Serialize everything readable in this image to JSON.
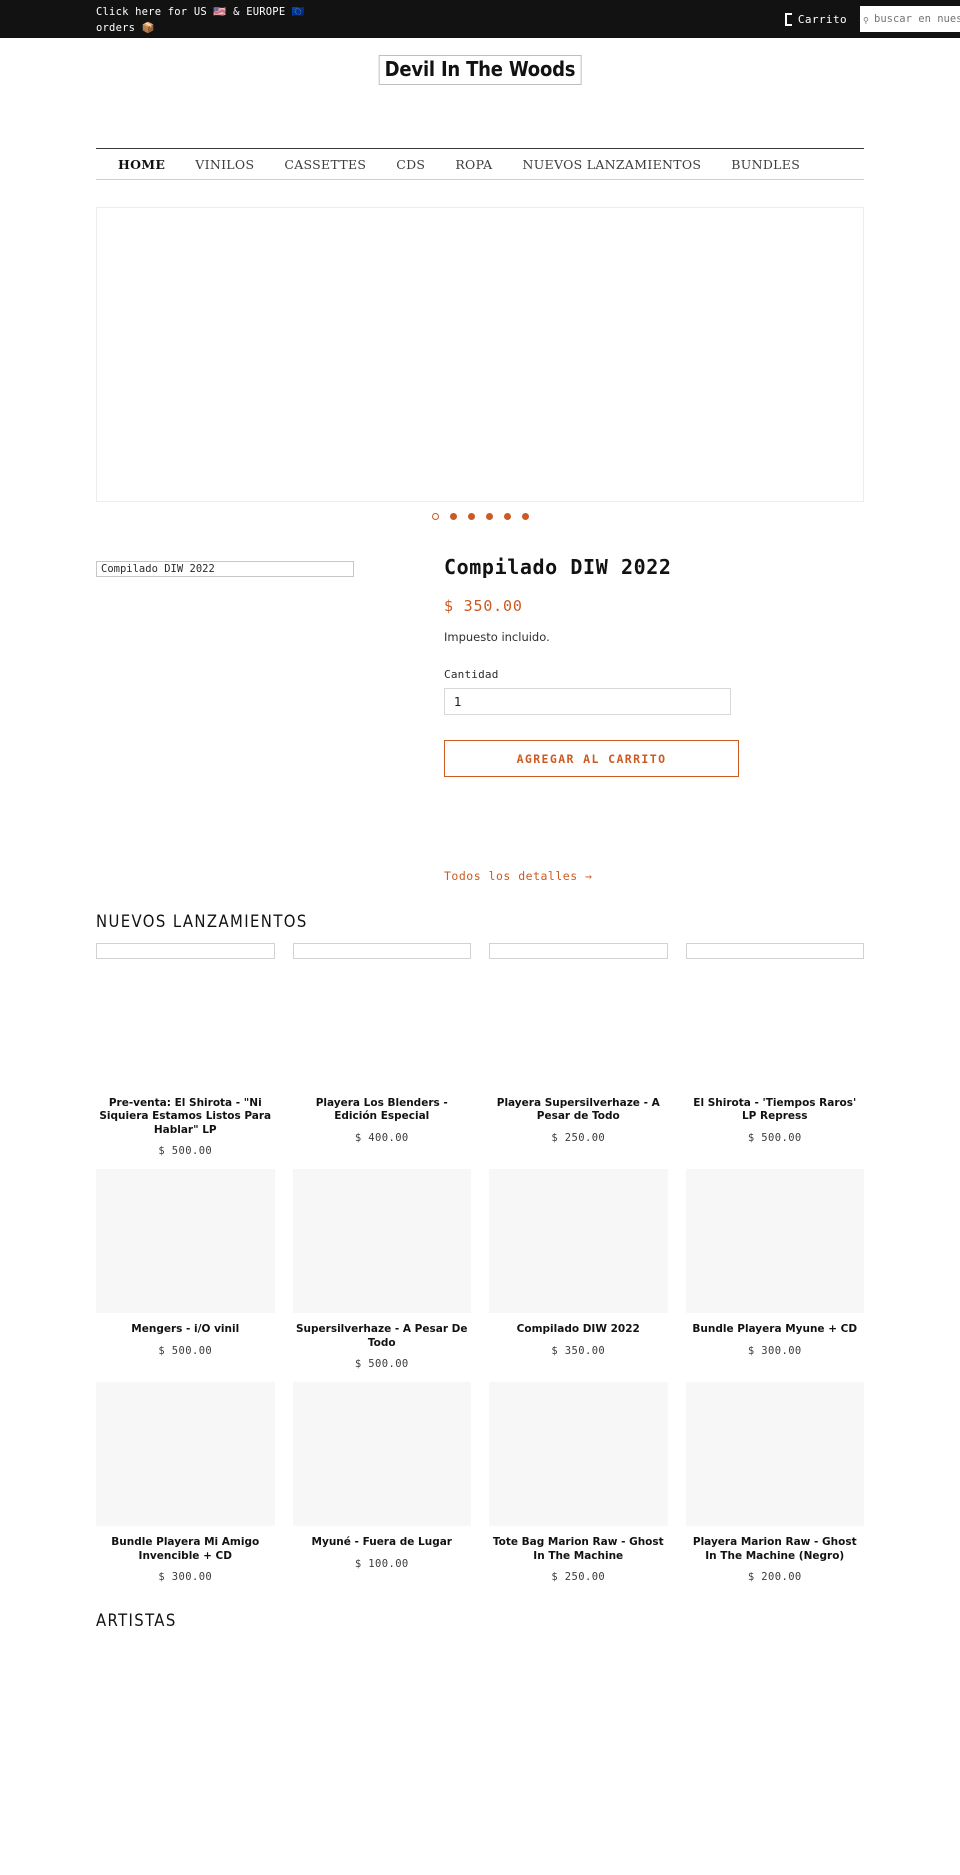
{
  "announcement": {
    "text": "Click here for US 🇺🇸 & EUROPE 🇪🇺 orders 📦",
    "cart_label": "Carrito",
    "cart_icon": "cart-icon",
    "search_placeholder": "buscar en nuestra tienda",
    "search_value": "",
    "search_icon": "search-icon"
  },
  "header": {
    "logo_alt": "Devil In The Woods"
  },
  "nav": {
    "items": [
      {
        "label": "HOME",
        "active": true
      },
      {
        "label": "VINILOS",
        "active": false
      },
      {
        "label": "CASSETTES",
        "active": false
      },
      {
        "label": "CDS",
        "active": false
      },
      {
        "label": "ROPA",
        "active": false
      },
      {
        "label": "NUEVOS LANZAMIENTOS",
        "active": false
      },
      {
        "label": "BUNDLES",
        "active": false
      }
    ]
  },
  "carousel": {
    "slide_count": 6,
    "current_index": 0,
    "dot_color": "#cc5a22"
  },
  "featured": {
    "image_alt": "Compilado DIW 2022",
    "title": "Compilado DIW 2022",
    "price": "$ 350.00",
    "tax_note": "Impuesto incluido.",
    "quantity_label": "Cantidad",
    "quantity_value": "1",
    "add_to_cart_label": "AGREGAR AL CARRITO",
    "details_label": "Todos los detalles →",
    "accent_color": "#cc5a22"
  },
  "sections": [
    {
      "heading": "NUEVOS LANZAMIENTOS",
      "rows": [
        {
          "media_style": "alt",
          "products": [
            {
              "title": "Pre-venta: El Shirota - \"Ni Siquiera Estamos Listos Para Hablar\" LP",
              "price": "$ 500.00",
              "image_alt": ""
            },
            {
              "title": "Playera Los Blenders - Edición Especial",
              "price": "$ 400.00",
              "image_alt": ""
            },
            {
              "title": "Playera Supersilverhaze - A Pesar de Todo",
              "price": "$ 250.00",
              "image_alt": ""
            },
            {
              "title": "El Shirota - 'Tiempos Raros' LP Repress",
              "price": "$ 500.00",
              "image_alt": ""
            }
          ]
        },
        {
          "media_style": "placeholder",
          "products": [
            {
              "title": "Mengers - i/O vinil",
              "price": "$ 500.00",
              "image_alt": ""
            },
            {
              "title": "Supersilverhaze - A Pesar De Todo",
              "price": "$ 500.00",
              "image_alt": ""
            },
            {
              "title": "Compilado DIW 2022",
              "price": "$ 350.00",
              "image_alt": ""
            },
            {
              "title": "Bundle Playera Myune + CD",
              "price": "$ 300.00",
              "image_alt": ""
            }
          ]
        },
        {
          "media_style": "placeholder",
          "products": [
            {
              "title": "Bundle Playera Mi Amigo Invencible + CD",
              "price": "$ 300.00",
              "image_alt": ""
            },
            {
              "title": "Myuné - Fuera de Lugar",
              "price": "$ 100.00",
              "image_alt": ""
            },
            {
              "title": "Tote Bag Marion Raw - Ghost In The Machine",
              "price": "$ 250.00",
              "image_alt": ""
            },
            {
              "title": "Playera Marion Raw - Ghost In The Machine (Negro)",
              "price": "$ 200.00",
              "image_alt": ""
            }
          ]
        }
      ]
    },
    {
      "heading": "ARTISTAS",
      "rows": []
    }
  ]
}
